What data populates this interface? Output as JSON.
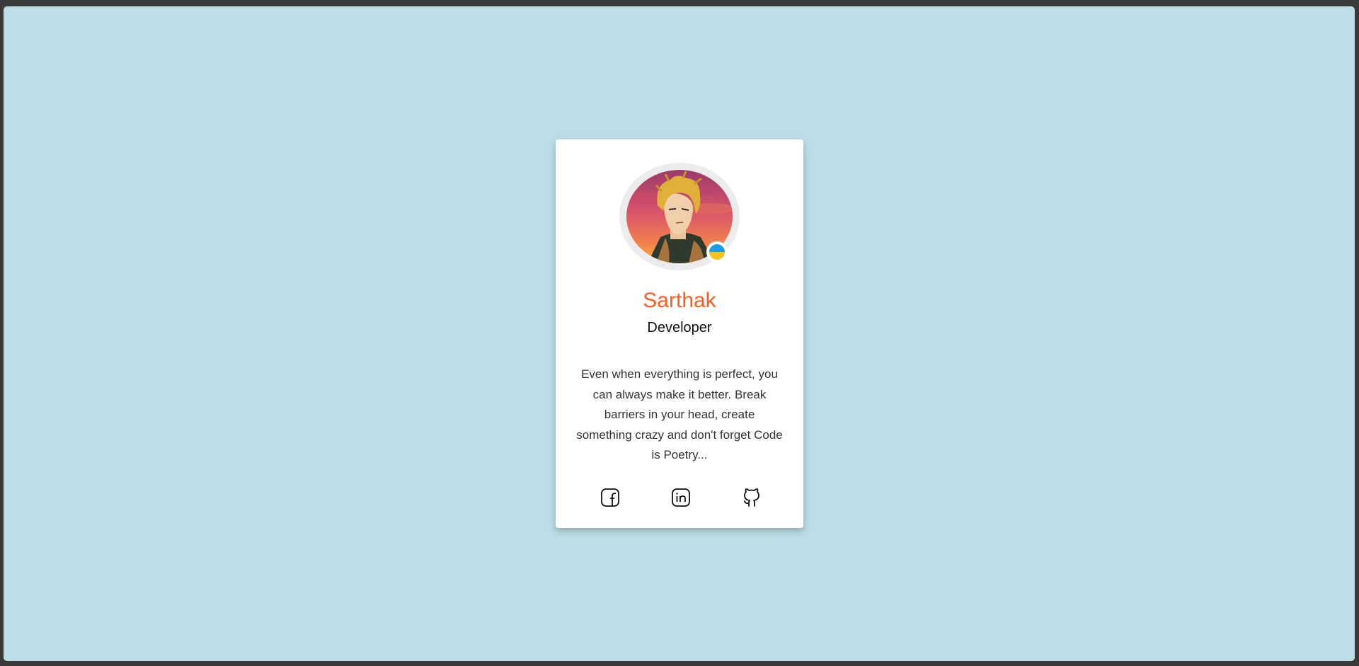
{
  "profile": {
    "name": "Sarthak",
    "role": "Developer",
    "bio": "Even when everything is perfect, you can always make it better. Break barriers in your head, create something crazy and don't forget Code is Poetry...",
    "status_colors": {
      "top": "#1e9be8",
      "bottom": "#f7c21b"
    }
  },
  "colors": {
    "background": "#bcdee6",
    "name": "#ff5a1f",
    "card": "#ffffff"
  },
  "socials": [
    {
      "icon": "facebook-icon"
    },
    {
      "icon": "linkedin-icon"
    },
    {
      "icon": "github-icon"
    }
  ]
}
